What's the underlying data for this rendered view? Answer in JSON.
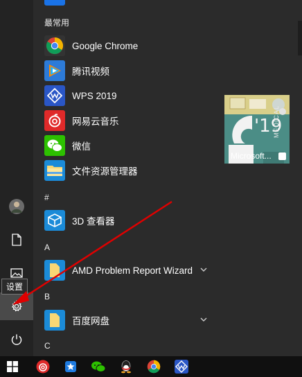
{
  "sections": {
    "most_used": "最常用",
    "hash": "#",
    "a": "A",
    "b": "B",
    "c": "C"
  },
  "apps": {
    "chrome": "Google Chrome",
    "tencent_video": "腾讯视频",
    "wps": "WPS 2019",
    "netease_music": "网易云音乐",
    "wechat": "微信",
    "explorer": "文件资源管理器",
    "viewer_3d": "3D 查看器",
    "amd": "AMD Problem Report Wizard",
    "baidu": "百度网盘"
  },
  "tile": {
    "label": "Microsoft...",
    "year": "'19",
    "side_text": "MEDICAL"
  },
  "tooltip": "设置",
  "colors": {
    "accent": "#e81123",
    "background": "#2b2b2b",
    "taskbar": "#101010"
  }
}
